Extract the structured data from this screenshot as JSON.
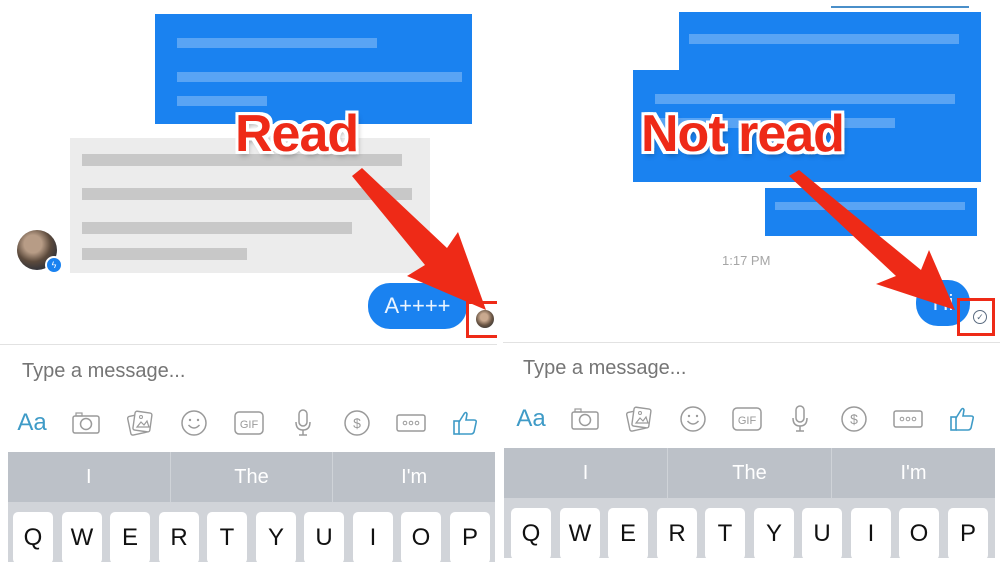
{
  "panels": [
    {
      "id": "read",
      "annotation": "Read",
      "sent_message": "A++++",
      "receipt": "seen-avatar",
      "composer": {
        "placeholder": "Type a message...",
        "toolbar": [
          {
            "icon": "text-format-icon",
            "label": "Aa"
          },
          {
            "icon": "camera-icon"
          },
          {
            "icon": "photos-icon"
          },
          {
            "icon": "emoji-icon"
          },
          {
            "icon": "gif-icon",
            "label": "GIF"
          },
          {
            "icon": "microphone-icon"
          },
          {
            "icon": "payment-icon",
            "label": "$"
          },
          {
            "icon": "more-icon",
            "label": "ooo"
          },
          {
            "icon": "thumbs-up-icon"
          }
        ]
      },
      "keyboard": {
        "suggestions": [
          "I",
          "The",
          "I'm"
        ],
        "row1": [
          "Q",
          "W",
          "E",
          "R",
          "T",
          "Y",
          "U",
          "I",
          "O",
          "P"
        ]
      }
    },
    {
      "id": "not-read",
      "annotation": "Not read",
      "timestamp": "1:17 PM",
      "sent_message": "Hi",
      "receipt": "sent-check-icon",
      "composer": {
        "placeholder": "Type a message...",
        "toolbar": [
          {
            "icon": "text-format-icon",
            "label": "Aa"
          },
          {
            "icon": "camera-icon"
          },
          {
            "icon": "photos-icon"
          },
          {
            "icon": "emoji-icon"
          },
          {
            "icon": "gif-icon",
            "label": "GIF"
          },
          {
            "icon": "microphone-icon"
          },
          {
            "icon": "payment-icon",
            "label": "$"
          },
          {
            "icon": "more-icon",
            "label": "ooo"
          },
          {
            "icon": "thumbs-up-icon"
          }
        ]
      },
      "keyboard": {
        "suggestions": [
          "I",
          "The",
          "I'm"
        ],
        "row1": [
          "Q",
          "W",
          "E",
          "R",
          "T",
          "Y",
          "U",
          "I",
          "O",
          "P"
        ]
      }
    }
  ],
  "colors": {
    "messenger_blue": "#1a82f0",
    "annotation_red": "#ee2a17",
    "icon_accent": "#3f9bc7",
    "keyboard_suggestion_bg": "#bcc1c8"
  },
  "check_glyph": "✓",
  "messenger_bolt": "ϟ"
}
